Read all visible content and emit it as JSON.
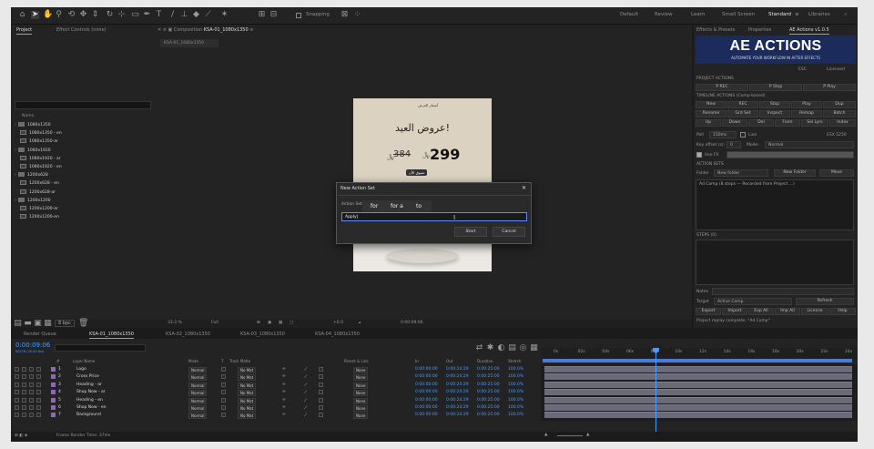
{
  "toolbar": {
    "snapping_label": "Snapping",
    "workspaces": [
      "Default",
      "Review",
      "Learn",
      "Small Screen",
      "Standard",
      "Libraries"
    ],
    "active_workspace": "Standard"
  },
  "project": {
    "tab_project": "Project",
    "tab_effects": "Effect Controls (none)",
    "column_name": "Name",
    "items": [
      {
        "label": "1080x1350",
        "kind": "folder",
        "indent": 0
      },
      {
        "label": "1080x1350 - en",
        "kind": "comp",
        "indent": 1
      },
      {
        "label": "1080x1350-ar",
        "kind": "comp",
        "indent": 1
      },
      {
        "label": "1080x1920",
        "kind": "folder",
        "indent": 0
      },
      {
        "label": "1080x1920 - ar",
        "kind": "comp",
        "indent": 1
      },
      {
        "label": "1080x1920 - en",
        "kind": "comp",
        "indent": 1
      },
      {
        "label": "1200x628",
        "kind": "folder",
        "indent": 0
      },
      {
        "label": "1200x628 - en",
        "kind": "comp",
        "indent": 1
      },
      {
        "label": "1200x628-ar",
        "kind": "comp",
        "indent": 1
      },
      {
        "label": "1200x1200",
        "kind": "folder",
        "indent": 0
      },
      {
        "label": "1200x1200-ar",
        "kind": "comp",
        "indent": 1
      },
      {
        "label": "1200x1200-en",
        "kind": "comp",
        "indent": 1
      }
    ],
    "bpc": "8 bpc"
  },
  "viewer": {
    "comp_tab_prefix": "Composition",
    "comp_tab_name": "KSA-01_1080x1350",
    "sub_tab": "KSA-01_1080x1350",
    "zoom": "33.3 %",
    "resolution": "Full",
    "timecode": "0:00:09:06",
    "exposure": "+0.0"
  },
  "poster": {
    "logo": "أسعار العرض",
    "title": "عروض العيد!",
    "price": "299",
    "old_price": "384",
    "currency": "﷼",
    "shop_button": "تسوق الآن"
  },
  "dialog": {
    "title": "New Action Set",
    "field_label": "Action Set",
    "input_value": "Apply",
    "autocomplete": [
      "for",
      "for a",
      "to"
    ],
    "start_label": "Start",
    "cancel_label": "Cancel"
  },
  "ae_panel": {
    "tabs": [
      "Effects & Presets",
      "Properties",
      "AE Actions v1.0.5"
    ],
    "banner_title": "AE ACTIONS",
    "banner_tagline": "AUTOMATE YOUR WORKFLOW IN AFTER EFFECTS",
    "esc": "ESC",
    "license": "Licensed",
    "project_actions_label": "PROJECT ACTIONS",
    "p_rec": "P REC",
    "p_stop": "P Stop",
    "p_play": "P Play",
    "timeline_actions_label": "TIMELINE ACTIONS (Comp-based)",
    "tl_row1": [
      "New",
      "REC",
      "Stop",
      "Play",
      "Dup"
    ],
    "tl_row2": [
      "Rename",
      "Grd Set",
      "Inspect",
      "Remap",
      "Batch"
    ],
    "tl_row3": [
      "Up",
      "Down",
      "Del",
      "From",
      "Sel Lyrs",
      "Index"
    ],
    "poll_label": "Poll",
    "poll_value": "150ms",
    "live_label": "Live",
    "poll_right": "ESX 5250",
    "key_offset_label": "Key offset (s):",
    "key_offset_value": "0",
    "mode_label": "Mode:",
    "mode_value": "Normal",
    "use_fx": "Use FX",
    "action_sets_label": "ACTION SETS",
    "folder_label": "Folder",
    "folder_value": "New folder",
    "new_folder": "New Folder",
    "move": "Move",
    "action_set_item": "Ad Comp  (8 steps — Recorded from Project ...)",
    "steps_label": "STEPS (0)",
    "notes_label": "Notes",
    "target_label": "Target",
    "target_value": "Active Comp",
    "refresh": "Refresh",
    "bottom_buttons": [
      "Export",
      "Import",
      "Exp All",
      "Imp All",
      "License",
      "Help"
    ],
    "status": "Project replay complete: \"Ad Comp\""
  },
  "timeline": {
    "tabs": [
      "Render Queue",
      "KSA-01_1080x1350",
      "KSA-02_1080x1350",
      "KSA-03_1080x1350",
      "KSA-04_1080x1350"
    ],
    "timecode": "0:00:09:06",
    "timecode_sub": "00276 (30.00 fps)",
    "columns": [
      "#",
      "Layer Name",
      "Mode",
      "T",
      "Track Matte",
      "Parent & Link",
      "In",
      "Out",
      "Duration",
      "Stretch"
    ],
    "layers": [
      {
        "num": "1",
        "name": "Logo",
        "mode": "Normal",
        "matte": "No Mat",
        "parent": "None",
        "in": "0:00:00:00",
        "out": "0:00:24:29",
        "dur": "0:00:25:00",
        "stretch": "100.0%"
      },
      {
        "num": "2",
        "name": "Cross Price",
        "mode": "Normal",
        "matte": "No Mat",
        "parent": "None",
        "in": "0:00:00:00",
        "out": "0:00:24:29",
        "dur": "0:00:25:00",
        "stretch": "100.0%"
      },
      {
        "num": "3",
        "name": "Heading - ar",
        "mode": "Normal",
        "matte": "No Mat",
        "parent": "None",
        "in": "0:00:00:00",
        "out": "0:00:24:29",
        "dur": "0:00:25:00",
        "stretch": "100.0%"
      },
      {
        "num": "4",
        "name": "Shop Now - ar",
        "mode": "Normal",
        "matte": "No Mat",
        "parent": "None",
        "in": "0:00:00:00",
        "out": "0:00:24:29",
        "dur": "0:00:25:00",
        "stretch": "100.0%"
      },
      {
        "num": "5",
        "name": "Heading - en",
        "mode": "Normal",
        "matte": "No Mat",
        "parent": "None",
        "in": "0:00:00:00",
        "out": "0:00:24:29",
        "dur": "0:00:25:00",
        "stretch": "100.0%"
      },
      {
        "num": "6",
        "name": "Shop Now - en",
        "mode": "Normal",
        "matte": "No Mat",
        "parent": "None",
        "in": "0:00:00:00",
        "out": "0:00:24:29",
        "dur": "0:00:25:00",
        "stretch": "100.0%"
      },
      {
        "num": "7",
        "name": "Background",
        "mode": "Normal",
        "matte": "No Mat",
        "parent": "None",
        "in": "0:00:00:00",
        "out": "0:00:24:29",
        "dur": "0:00:25:00",
        "stretch": "100.0%"
      }
    ],
    "ruler": [
      "0s",
      "02s",
      "04s",
      "06s",
      "08s",
      "10s",
      "12s",
      "14s",
      "16s",
      "18s",
      "20s",
      "22s",
      "24s"
    ],
    "footer": "Frame Render Time: 37ms"
  },
  "colors": {
    "accent": "#4a9bff",
    "panel": "#232323",
    "banner": "#1a2b5c"
  }
}
